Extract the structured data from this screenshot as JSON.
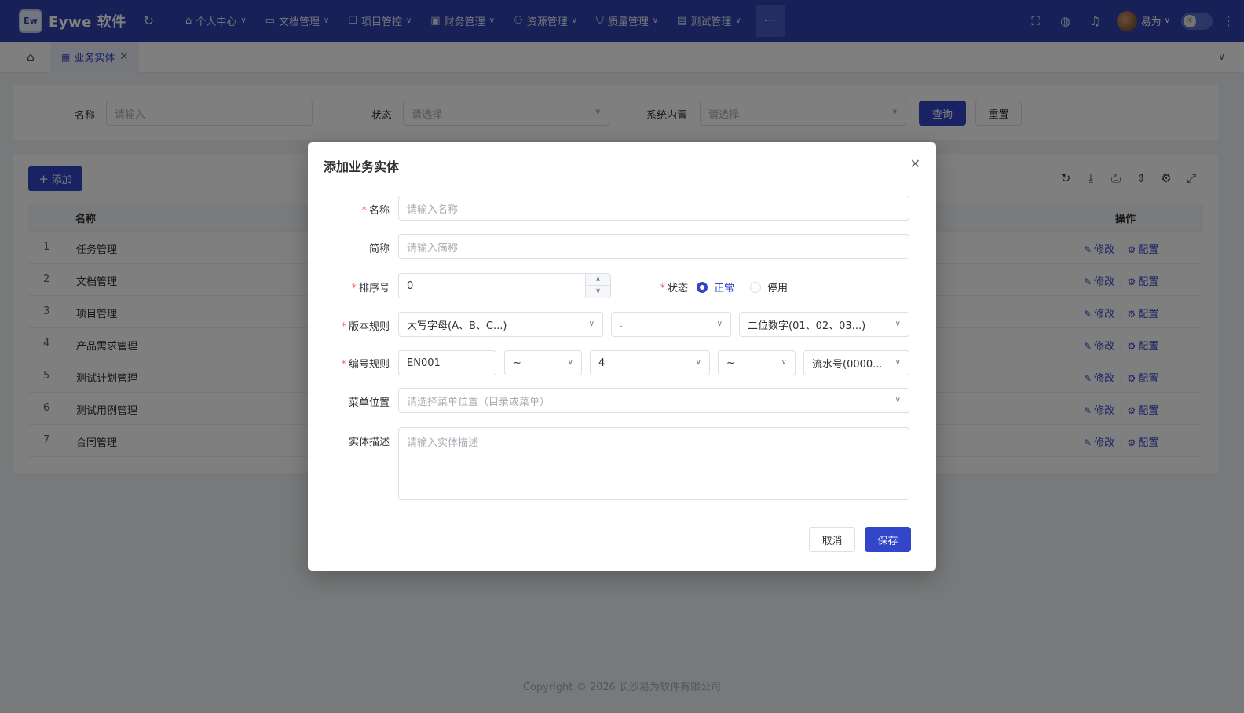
{
  "app": {
    "logo_mark": "Ew",
    "title": "Eywe 软件"
  },
  "nav": [
    {
      "label": "个人中心",
      "icon": "home-icon"
    },
    {
      "label": "文档管理",
      "icon": "folder-icon"
    },
    {
      "label": "项目管控",
      "icon": "project-icon"
    },
    {
      "label": "财务管理",
      "icon": "finance-icon"
    },
    {
      "label": "资源管理",
      "icon": "resource-icon"
    },
    {
      "label": "质量管理",
      "icon": "shield-icon"
    },
    {
      "label": "测试管理",
      "icon": "test-icon"
    }
  ],
  "more_label": "···",
  "user": {
    "name": "易为"
  },
  "tabs": {
    "active_label": "业务实体"
  },
  "search": {
    "name_label": "名称",
    "name_placeholder": "请输入",
    "status_label": "状态",
    "status_placeholder": "请选择",
    "builtin_label": "系统内置",
    "builtin_placeholder": "请选择",
    "query_label": "查询",
    "reset_label": "重置"
  },
  "table": {
    "add_label": "添加",
    "col_name": "名称",
    "col_ops": "操作",
    "edit_label": "修改",
    "config_label": "配置",
    "rows": [
      {
        "index": "1",
        "name": "任务管理"
      },
      {
        "index": "2",
        "name": "文档管理"
      },
      {
        "index": "3",
        "name": "项目管理"
      },
      {
        "index": "4",
        "name": "产品需求管理"
      },
      {
        "index": "5",
        "name": "测试计划管理"
      },
      {
        "index": "6",
        "name": "测试用例管理"
      },
      {
        "index": "7",
        "name": "合同管理"
      }
    ]
  },
  "footer": "Copyright © 2026 长沙易为软件有限公司",
  "dialog": {
    "title": "添加业务实体",
    "name_label": "名称",
    "name_placeholder": "请输入名称",
    "short_label": "简称",
    "short_placeholder": "请输入简称",
    "order_label": "排序号",
    "order_value": "0",
    "status_label": "状态",
    "status_normal": "正常",
    "status_disabled": "停用",
    "version_label": "版本规则",
    "version_1": "大写字母(A、B、C...)",
    "version_2": ".",
    "version_3": "二位数字(01、02、03...)",
    "code_label": "编号规则",
    "code_prefix": "EN001",
    "code_sep1": "~",
    "code_len": "4",
    "code_sep2": "~",
    "code_type": "流水号(0000...",
    "menu_label": "菜单位置",
    "menu_placeholder": "请选择菜单位置（目录或菜单）",
    "desc_label": "实体描述",
    "desc_placeholder": "请输入实体描述",
    "cancel_label": "取消",
    "save_label": "保存"
  },
  "colors": {
    "primary": "#3346c9",
    "header": "#2f42b0",
    "required": "#f56c6c"
  }
}
